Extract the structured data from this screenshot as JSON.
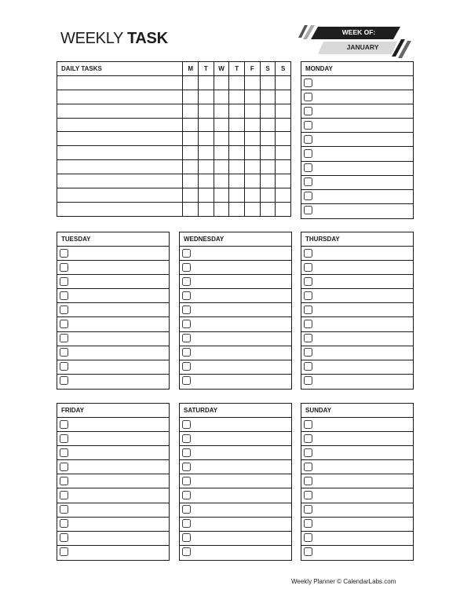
{
  "header": {
    "title_regular": "WEEKLY",
    "title_bold": "TASK",
    "week_of_label": "WEEK OF:",
    "month": "JANUARY"
  },
  "daily_tasks": {
    "header": "DAILY TASKS",
    "day_columns": [
      "M",
      "T",
      "W",
      "T",
      "F",
      "S",
      "S"
    ],
    "row_count": 10
  },
  "days": [
    {
      "name": "MONDAY",
      "rows": 10
    },
    {
      "name": "TUESDAY",
      "rows": 10
    },
    {
      "name": "WEDNESDAY",
      "rows": 10
    },
    {
      "name": "THURSDAY",
      "rows": 10
    },
    {
      "name": "FRIDAY",
      "rows": 10
    },
    {
      "name": "SATURDAY",
      "rows": 10
    },
    {
      "name": "SUNDAY",
      "rows": 10
    }
  ],
  "footer": {
    "text": "Weekly Planner © CalendarLabs.com"
  },
  "colors": {
    "banner_dark": "#1e1e1e",
    "banner_light": "#d9d9d9",
    "stripe": "#555555"
  }
}
